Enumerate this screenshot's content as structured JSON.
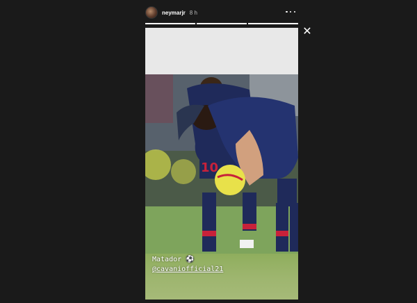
{
  "story": {
    "username": "neymarjr",
    "time": "8 h",
    "progress": [
      1.0,
      1.0,
      1.0
    ],
    "caption": {
      "line1": "Matador ⚽",
      "mention": "@cavaniofficial21"
    },
    "photo_description_labels": {
      "jersey_number": "10"
    }
  },
  "icons": {
    "more": "more-options-icon",
    "close": "close-icon"
  },
  "colors": {
    "background": "#1a1a1a",
    "text": "#ffffff",
    "kit_navy": "#1f2a5a",
    "kit_red": "#c8213a"
  }
}
